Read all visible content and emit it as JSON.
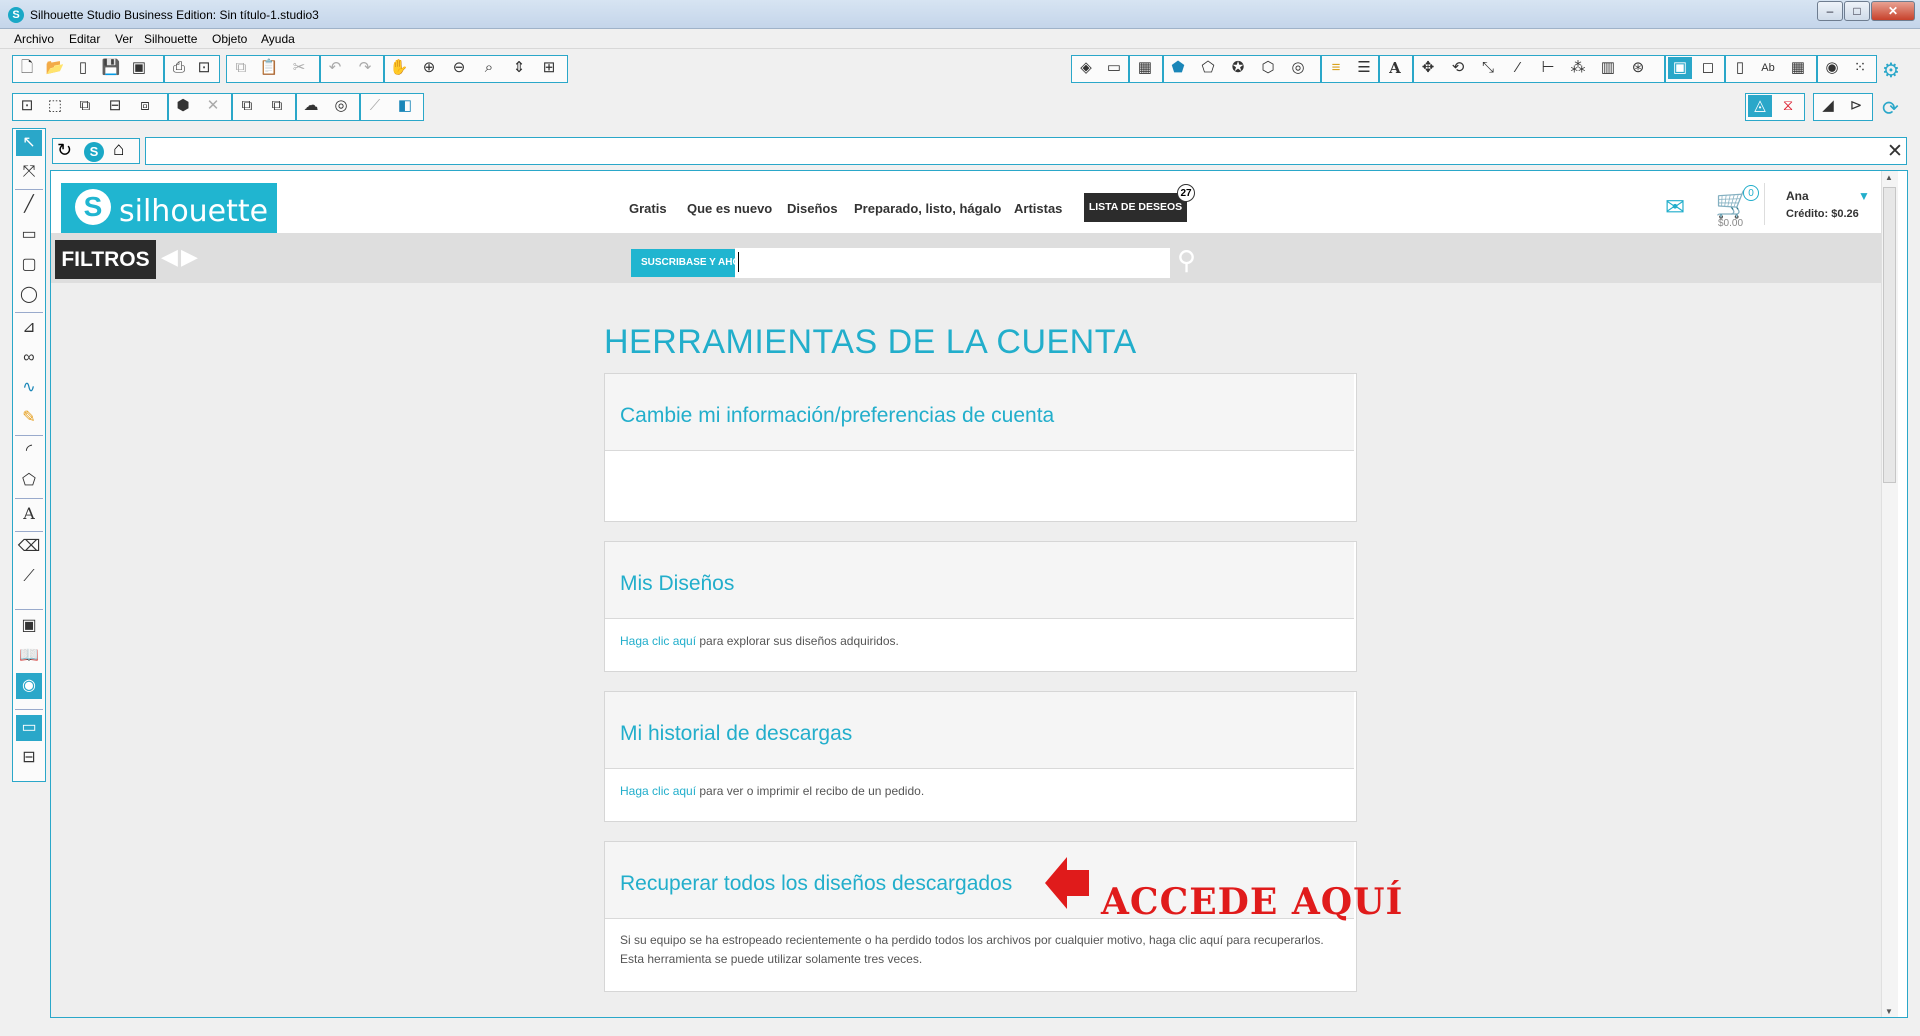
{
  "window": {
    "title": "Silhouette Studio Business Edition: Sin título-1.studio3"
  },
  "menu": [
    "Archivo",
    "Editar",
    "Ver",
    "Silhouette",
    "Objeto",
    "Ayuda"
  ],
  "browser": {
    "address_value": "",
    "site": {
      "logo_text": "silhouette",
      "nav": [
        "Gratis",
        "Que es nuevo",
        "Diseños",
        "Preparado, listo, hágalo",
        "Artistas"
      ],
      "wishlist_label": "LISTA DE DESEOS",
      "wishlist_count": "27",
      "cart_count": "0",
      "cart_total": "$0.00",
      "user_name": "Ana",
      "credit": "Crédito: $0.26",
      "filters_label": "FILTROS",
      "subscribe_label": "SUSCRIBASE Y AHO",
      "search_value": "",
      "page_title": "HERRAMIENTAS DE LA CUENTA",
      "cards": [
        {
          "title": "Cambie mi información/preferencias de cuenta",
          "link": "",
          "text": ""
        },
        {
          "title": "Mis Diseños",
          "link": "Haga clic aquí",
          "text": " para explorar sus diseños adquiridos."
        },
        {
          "title": "Mi historial de descargas",
          "link": "Haga clic aquí",
          "text": " para ver o imprimir el recibo de un pedido."
        },
        {
          "title": "Recuperar todos los diseños descargados",
          "link": "",
          "text": "Si su equipo se ha estropeado recientemente o ha perdido todos los archivos por cualquier motivo, haga clic aquí para recuperarlos. Esta herramienta se puede utilizar solamente tres veces."
        }
      ],
      "annotation": "ACCEDE AQUÍ"
    }
  },
  "colors": {
    "accent": "#22aecb",
    "annotation": "#e01b1b",
    "toolbar_border": "#2aa7c9"
  }
}
